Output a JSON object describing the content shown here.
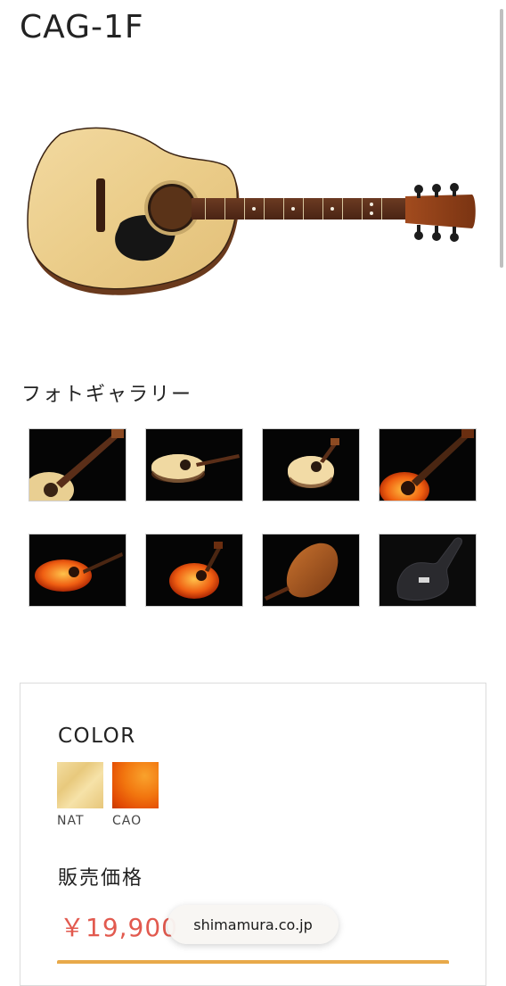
{
  "product": {
    "title": "CAG-1F"
  },
  "gallery": {
    "title": "フォトギャラリー",
    "thumbnails": [
      {
        "name": "thumb-nat-neck-closeup"
      },
      {
        "name": "thumb-nat-side"
      },
      {
        "name": "thumb-nat-front"
      },
      {
        "name": "thumb-cao-neck-closeup"
      },
      {
        "name": "thumb-cao-side"
      },
      {
        "name": "thumb-cao-front"
      },
      {
        "name": "thumb-back"
      },
      {
        "name": "thumb-gig-bag"
      }
    ]
  },
  "purchase": {
    "color_label": "COLOR",
    "colors": [
      {
        "code": "NAT",
        "swatch": "#EED59A"
      },
      {
        "code": "CAO",
        "swatch": "#F0700F"
      }
    ],
    "price_label": "販売価格",
    "price": "￥19,900"
  },
  "browser": {
    "domain": "shimamura.co.jp"
  },
  "theme": {
    "price_color": "#E25A4F",
    "cta_color": "#E8A94A"
  }
}
